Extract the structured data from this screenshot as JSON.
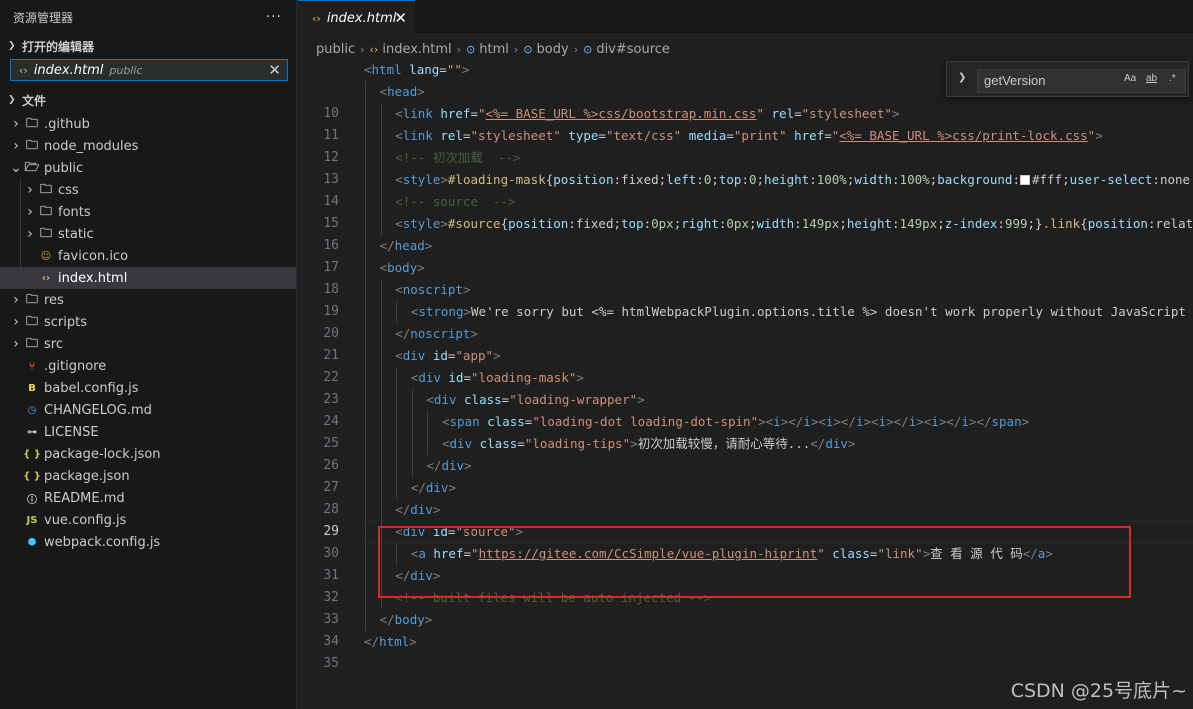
{
  "sidebar": {
    "title": "资源管理器",
    "more": "···",
    "open_editors_label": "打开的编辑器",
    "open_editor": {
      "name": "index.html",
      "dir": "public",
      "close": "✕"
    },
    "folder_label": "文件",
    "tree": [
      {
        "name": ".github",
        "kind": "folder",
        "depth": 0,
        "expanded": false
      },
      {
        "name": "node_modules",
        "kind": "folder",
        "depth": 0,
        "expanded": false
      },
      {
        "name": "public",
        "kind": "folder",
        "depth": 0,
        "expanded": true
      },
      {
        "name": "css",
        "kind": "folder",
        "depth": 1,
        "expanded": false
      },
      {
        "name": "fonts",
        "kind": "folder",
        "depth": 1,
        "expanded": false
      },
      {
        "name": "static",
        "kind": "folder",
        "depth": 1,
        "expanded": false
      },
      {
        "name": "favicon.ico",
        "kind": "favicon",
        "depth": 1
      },
      {
        "name": "index.html",
        "kind": "html",
        "depth": 1,
        "selected": true
      },
      {
        "name": "res",
        "kind": "folder",
        "depth": 0,
        "expanded": false
      },
      {
        "name": "scripts",
        "kind": "folder",
        "depth": 0,
        "expanded": false
      },
      {
        "name": "src",
        "kind": "folder",
        "depth": 0,
        "expanded": false
      },
      {
        "name": ".gitignore",
        "kind": "git",
        "depth": 0
      },
      {
        "name": "babel.config.js",
        "kind": "babel",
        "depth": 0
      },
      {
        "name": "CHANGELOG.md",
        "kind": "changelog",
        "depth": 0
      },
      {
        "name": "LICENSE",
        "kind": "license",
        "depth": 0
      },
      {
        "name": "package-lock.json",
        "kind": "json",
        "depth": 0
      },
      {
        "name": "package.json",
        "kind": "json",
        "depth": 0
      },
      {
        "name": "README.md",
        "kind": "readme",
        "depth": 0
      },
      {
        "name": "vue.config.js",
        "kind": "js",
        "depth": 0
      },
      {
        "name": "webpack.config.js",
        "kind": "webpack",
        "depth": 0
      }
    ]
  },
  "tab": {
    "name": "index.html",
    "close": "✕"
  },
  "breadcrumb": [
    "public",
    "index.html",
    "html",
    "body",
    "div#source"
  ],
  "find": {
    "value": "getVersion",
    "opt_case": "Aa",
    "opt_word": "ab",
    "opt_regex": ".*"
  },
  "editor": {
    "current_line": 29
  },
  "code_lines": [
    {
      "n": "",
      "indent": 0,
      "seg": [
        [
          "p",
          "<"
        ],
        [
          "t",
          "html"
        ],
        [
          "a",
          " lang"
        ],
        [
          "w",
          "="
        ],
        [
          "s",
          "\"\""
        ],
        [
          "p",
          ">"
        ]
      ]
    },
    {
      "n": "",
      "indent": 1,
      "seg": [
        [
          "p",
          "<"
        ],
        [
          "t",
          "head"
        ],
        [
          "p",
          ">"
        ]
      ]
    },
    {
      "n": "10",
      "indent": 2,
      "seg": [
        [
          "p",
          "<"
        ],
        [
          "t",
          "link"
        ],
        [
          "a",
          " href"
        ],
        [
          "w",
          "="
        ],
        [
          "s",
          "\""
        ],
        [
          "u",
          "<%= BASE_URL %>css/bootstrap.min.css"
        ],
        [
          "s",
          "\""
        ],
        [
          "a",
          " rel"
        ],
        [
          "w",
          "="
        ],
        [
          "s",
          "\"stylesheet\""
        ],
        [
          "p",
          ">"
        ]
      ]
    },
    {
      "n": "11",
      "indent": 2,
      "seg": [
        [
          "p",
          "<"
        ],
        [
          "t",
          "link"
        ],
        [
          "a",
          " rel"
        ],
        [
          "w",
          "="
        ],
        [
          "s",
          "\"stylesheet\""
        ],
        [
          "a",
          " type"
        ],
        [
          "w",
          "="
        ],
        [
          "s",
          "\"text/css\""
        ],
        [
          "a",
          " media"
        ],
        [
          "w",
          "="
        ],
        [
          "s",
          "\"print\""
        ],
        [
          "a",
          " href"
        ],
        [
          "w",
          "="
        ],
        [
          "s",
          "\""
        ],
        [
          "u",
          "<%= BASE_URL %>css/print-lock.css"
        ],
        [
          "s",
          "\""
        ],
        [
          "p",
          ">"
        ]
      ]
    },
    {
      "n": "12",
      "indent": 2,
      "seg": [
        [
          "c",
          "<!-- 初次加载  -->"
        ]
      ]
    },
    {
      "n": "13",
      "indent": 2,
      "seg": [
        [
          "p",
          "<"
        ],
        [
          "t",
          "style"
        ],
        [
          "p",
          ">"
        ],
        [
          "csss",
          "#loading-mask"
        ],
        [
          "w",
          "{"
        ],
        [
          "cssp",
          "position"
        ],
        [
          "w",
          ":fixed;"
        ],
        [
          "cssp",
          "left"
        ],
        [
          "w",
          ":"
        ],
        [
          "cssv",
          "0"
        ],
        [
          "w",
          ";"
        ],
        [
          "cssp",
          "top"
        ],
        [
          "w",
          ":"
        ],
        [
          "cssv",
          "0"
        ],
        [
          "w",
          ";"
        ],
        [
          "cssp",
          "height"
        ],
        [
          "w",
          ":"
        ],
        [
          "cssv",
          "100%"
        ],
        [
          "w",
          ";"
        ],
        [
          "cssp",
          "width"
        ],
        [
          "w",
          ":"
        ],
        [
          "cssv",
          "100%"
        ],
        [
          "w",
          ";"
        ],
        [
          "cssp",
          "background"
        ],
        [
          "w",
          ":"
        ],
        [
          "sw",
          ""
        ],
        [
          "w",
          "#fff;"
        ],
        [
          "cssp",
          "user-select"
        ],
        [
          "w",
          ":none"
        ]
      ]
    },
    {
      "n": "14",
      "indent": 2,
      "seg": [
        [
          "c",
          "<!-- source  -->"
        ]
      ]
    },
    {
      "n": "15",
      "indent": 2,
      "seg": [
        [
          "p",
          "<"
        ],
        [
          "t",
          "style"
        ],
        [
          "p",
          ">"
        ],
        [
          "csss",
          "#source"
        ],
        [
          "w",
          "{"
        ],
        [
          "cssp",
          "position"
        ],
        [
          "w",
          ":fixed;"
        ],
        [
          "cssp",
          "top"
        ],
        [
          "w",
          ":"
        ],
        [
          "cssv",
          "0px"
        ],
        [
          "w",
          ";"
        ],
        [
          "cssp",
          "right"
        ],
        [
          "w",
          ":"
        ],
        [
          "cssv",
          "0px"
        ],
        [
          "w",
          ";"
        ],
        [
          "cssp",
          "width"
        ],
        [
          "w",
          ":"
        ],
        [
          "cssv",
          "149px"
        ],
        [
          "w",
          ";"
        ],
        [
          "cssp",
          "height"
        ],
        [
          "w",
          ":"
        ],
        [
          "cssv",
          "149px"
        ],
        [
          "w",
          ";"
        ],
        [
          "cssp",
          "z-index"
        ],
        [
          "w",
          ":"
        ],
        [
          "cssv",
          "999"
        ],
        [
          "w",
          ";}"
        ],
        [
          "csss",
          ".link"
        ],
        [
          "w",
          "{"
        ],
        [
          "cssp",
          "position"
        ],
        [
          "w",
          ":relative"
        ]
      ]
    },
    {
      "n": "16",
      "indent": 1,
      "seg": [
        [
          "p",
          "</"
        ],
        [
          "t",
          "head"
        ],
        [
          "p",
          ">"
        ]
      ]
    },
    {
      "n": "17",
      "indent": 1,
      "seg": [
        [
          "p",
          "<"
        ],
        [
          "t",
          "body"
        ],
        [
          "p",
          ">"
        ]
      ]
    },
    {
      "n": "18",
      "indent": 2,
      "seg": [
        [
          "p",
          "<"
        ],
        [
          "t",
          "noscript"
        ],
        [
          "p",
          ">"
        ]
      ]
    },
    {
      "n": "19",
      "indent": 3,
      "seg": [
        [
          "p",
          "<"
        ],
        [
          "t",
          "strong"
        ],
        [
          "p",
          ">"
        ],
        [
          "w",
          "We're sorry but <%= htmlWebpackPlugin.options.title %> doesn't work properly without JavaScript"
        ]
      ]
    },
    {
      "n": "20",
      "indent": 2,
      "seg": [
        [
          "p",
          "</"
        ],
        [
          "t",
          "noscript"
        ],
        [
          "p",
          ">"
        ]
      ]
    },
    {
      "n": "21",
      "indent": 2,
      "seg": [
        [
          "p",
          "<"
        ],
        [
          "t",
          "div"
        ],
        [
          "a",
          " id"
        ],
        [
          "w",
          "="
        ],
        [
          "s",
          "\"app\""
        ],
        [
          "p",
          ">"
        ]
      ]
    },
    {
      "n": "22",
      "indent": 3,
      "seg": [
        [
          "p",
          "<"
        ],
        [
          "t",
          "div"
        ],
        [
          "a",
          " id"
        ],
        [
          "w",
          "="
        ],
        [
          "s",
          "\"loading-mask\""
        ],
        [
          "p",
          ">"
        ]
      ]
    },
    {
      "n": "23",
      "indent": 4,
      "seg": [
        [
          "p",
          "<"
        ],
        [
          "t",
          "div"
        ],
        [
          "a",
          " class"
        ],
        [
          "w",
          "="
        ],
        [
          "s",
          "\"loading-wrapper\""
        ],
        [
          "p",
          ">"
        ]
      ]
    },
    {
      "n": "24",
      "indent": 5,
      "seg": [
        [
          "p",
          "<"
        ],
        [
          "t",
          "span"
        ],
        [
          "a",
          " class"
        ],
        [
          "w",
          "="
        ],
        [
          "s",
          "\"loading-dot loading-dot-spin\""
        ],
        [
          "p",
          ">"
        ],
        [
          "p",
          "<"
        ],
        [
          "t",
          "i"
        ],
        [
          "p",
          "></"
        ],
        [
          "t",
          "i"
        ],
        [
          "p",
          "><"
        ],
        [
          "t",
          "i"
        ],
        [
          "p",
          "></"
        ],
        [
          "t",
          "i"
        ],
        [
          "p",
          "><"
        ],
        [
          "t",
          "i"
        ],
        [
          "p",
          "></"
        ],
        [
          "t",
          "i"
        ],
        [
          "p",
          "><"
        ],
        [
          "t",
          "i"
        ],
        [
          "p",
          "></"
        ],
        [
          "t",
          "i"
        ],
        [
          "p",
          "></"
        ],
        [
          "t",
          "span"
        ],
        [
          "p",
          ">"
        ]
      ]
    },
    {
      "n": "25",
      "indent": 5,
      "seg": [
        [
          "p",
          "<"
        ],
        [
          "t",
          "div"
        ],
        [
          "a",
          " class"
        ],
        [
          "w",
          "="
        ],
        [
          "s",
          "\"loading-tips\""
        ],
        [
          "p",
          ">"
        ],
        [
          "w",
          "初次加载较慢，请耐心等待..."
        ],
        [
          "p",
          "</"
        ],
        [
          "t",
          "div"
        ],
        [
          "p",
          ">"
        ]
      ]
    },
    {
      "n": "26",
      "indent": 4,
      "seg": [
        [
          "p",
          "</"
        ],
        [
          "t",
          "div"
        ],
        [
          "p",
          ">"
        ]
      ]
    },
    {
      "n": "27",
      "indent": 3,
      "seg": [
        [
          "p",
          "</"
        ],
        [
          "t",
          "div"
        ],
        [
          "p",
          ">"
        ]
      ]
    },
    {
      "n": "28",
      "indent": 2,
      "seg": [
        [
          "p",
          "</"
        ],
        [
          "t",
          "div"
        ],
        [
          "p",
          ">"
        ]
      ]
    },
    {
      "n": "29",
      "indent": 2,
      "seg": [
        [
          "p",
          "<"
        ],
        [
          "t",
          "div"
        ],
        [
          "a",
          " id"
        ],
        [
          "w",
          "="
        ],
        [
          "s",
          "\"source\""
        ],
        [
          "p",
          ">"
        ]
      ]
    },
    {
      "n": "30",
      "indent": 3,
      "seg": [
        [
          "p",
          "<"
        ],
        [
          "t",
          "a"
        ],
        [
          "a",
          " href"
        ],
        [
          "w",
          "="
        ],
        [
          "s",
          "\""
        ],
        [
          "u",
          "https://gitee.com/CcSimple/vue-plugin-hiprint"
        ],
        [
          "s",
          "\""
        ],
        [
          "a",
          " class"
        ],
        [
          "w",
          "="
        ],
        [
          "s",
          "\"link\""
        ],
        [
          "p",
          ">"
        ],
        [
          "w",
          "查 看 源 代 码"
        ],
        [
          "p",
          "</"
        ],
        [
          "t",
          "a"
        ],
        [
          "p",
          ">"
        ]
      ]
    },
    {
      "n": "31",
      "indent": 2,
      "seg": [
        [
          "p",
          "</"
        ],
        [
          "t",
          "div"
        ],
        [
          "p",
          ">"
        ]
      ]
    },
    {
      "n": "32",
      "indent": 2,
      "seg": [
        [
          "c",
          "<!-- built files will be auto injected -->"
        ]
      ]
    },
    {
      "n": "33",
      "indent": 1,
      "seg": [
        [
          "p",
          "</"
        ],
        [
          "t",
          "body"
        ],
        [
          "p",
          ">"
        ]
      ]
    },
    {
      "n": "34",
      "indent": 0,
      "seg": [
        [
          "p",
          "</"
        ],
        [
          "t",
          "html"
        ],
        [
          "p",
          ">"
        ]
      ]
    },
    {
      "n": "35",
      "indent": 0,
      "seg": []
    }
  ],
  "watermark": "CSDN @25号底片~"
}
